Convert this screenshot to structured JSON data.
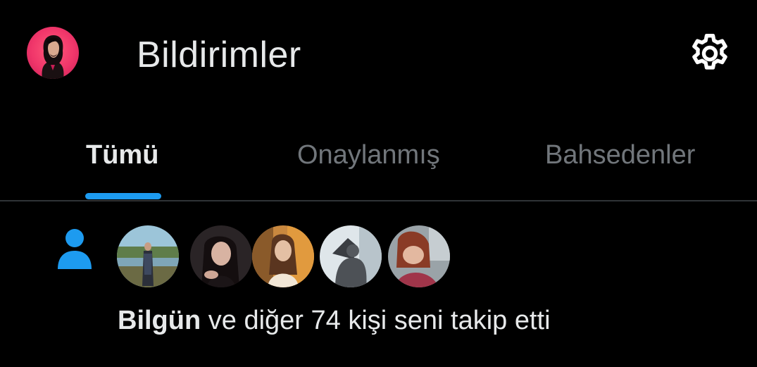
{
  "header": {
    "title": "Bildirimler",
    "avatar_icon": "profile-avatar",
    "settings_icon": "gear-icon"
  },
  "tabs": [
    {
      "label": "Tümü",
      "active": true
    },
    {
      "label": "Onaylanmış",
      "active": false
    },
    {
      "label": "Bahsedenler",
      "active": false
    }
  ],
  "notification": {
    "type_icon": "person-icon",
    "follower_avatars": [
      "follower-avatar-1",
      "follower-avatar-2",
      "follower-avatar-3",
      "follower-avatar-4",
      "follower-avatar-5"
    ],
    "actor_name": "Bilgün",
    "message": " ve diğer 74 kişi seni takip etti"
  },
  "colors": {
    "background": "#000000",
    "text_primary": "#e7e9ea",
    "text_secondary": "#71767b",
    "accent": "#1d9bf0",
    "divider": "#2f3336",
    "avatar_bg": "#f0366a"
  }
}
